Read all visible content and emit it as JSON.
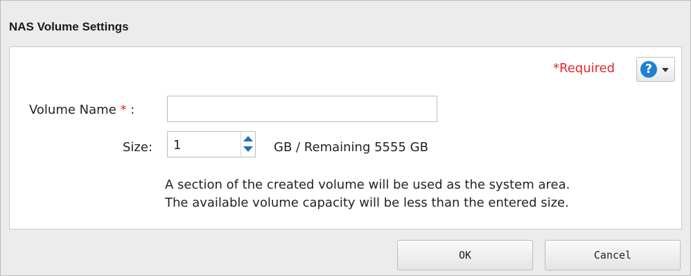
{
  "dialog": {
    "title": "NAS Volume Settings",
    "required_label": "*Required",
    "help_icon": "question-circle-icon",
    "help_dropdown_icon": "caret-down-icon"
  },
  "form": {
    "volume_name_label": "Volume Name",
    "volume_name_star": "*",
    "volume_name_colon": " :",
    "volume_name_value": "",
    "size_label": "Size:",
    "size_value": "1",
    "remaining_text": "GB / Remaining 5555 GB",
    "note_line1": "A section of the created volume will be used as the system area.",
    "note_line2": "The available volume capacity will be less than the entered size."
  },
  "buttons": {
    "ok": "OK",
    "cancel": "Cancel"
  },
  "colors": {
    "required": "#e8262b",
    "help_icon": "#1f7fd0",
    "spinner_arrow": "#1f6fc0"
  }
}
